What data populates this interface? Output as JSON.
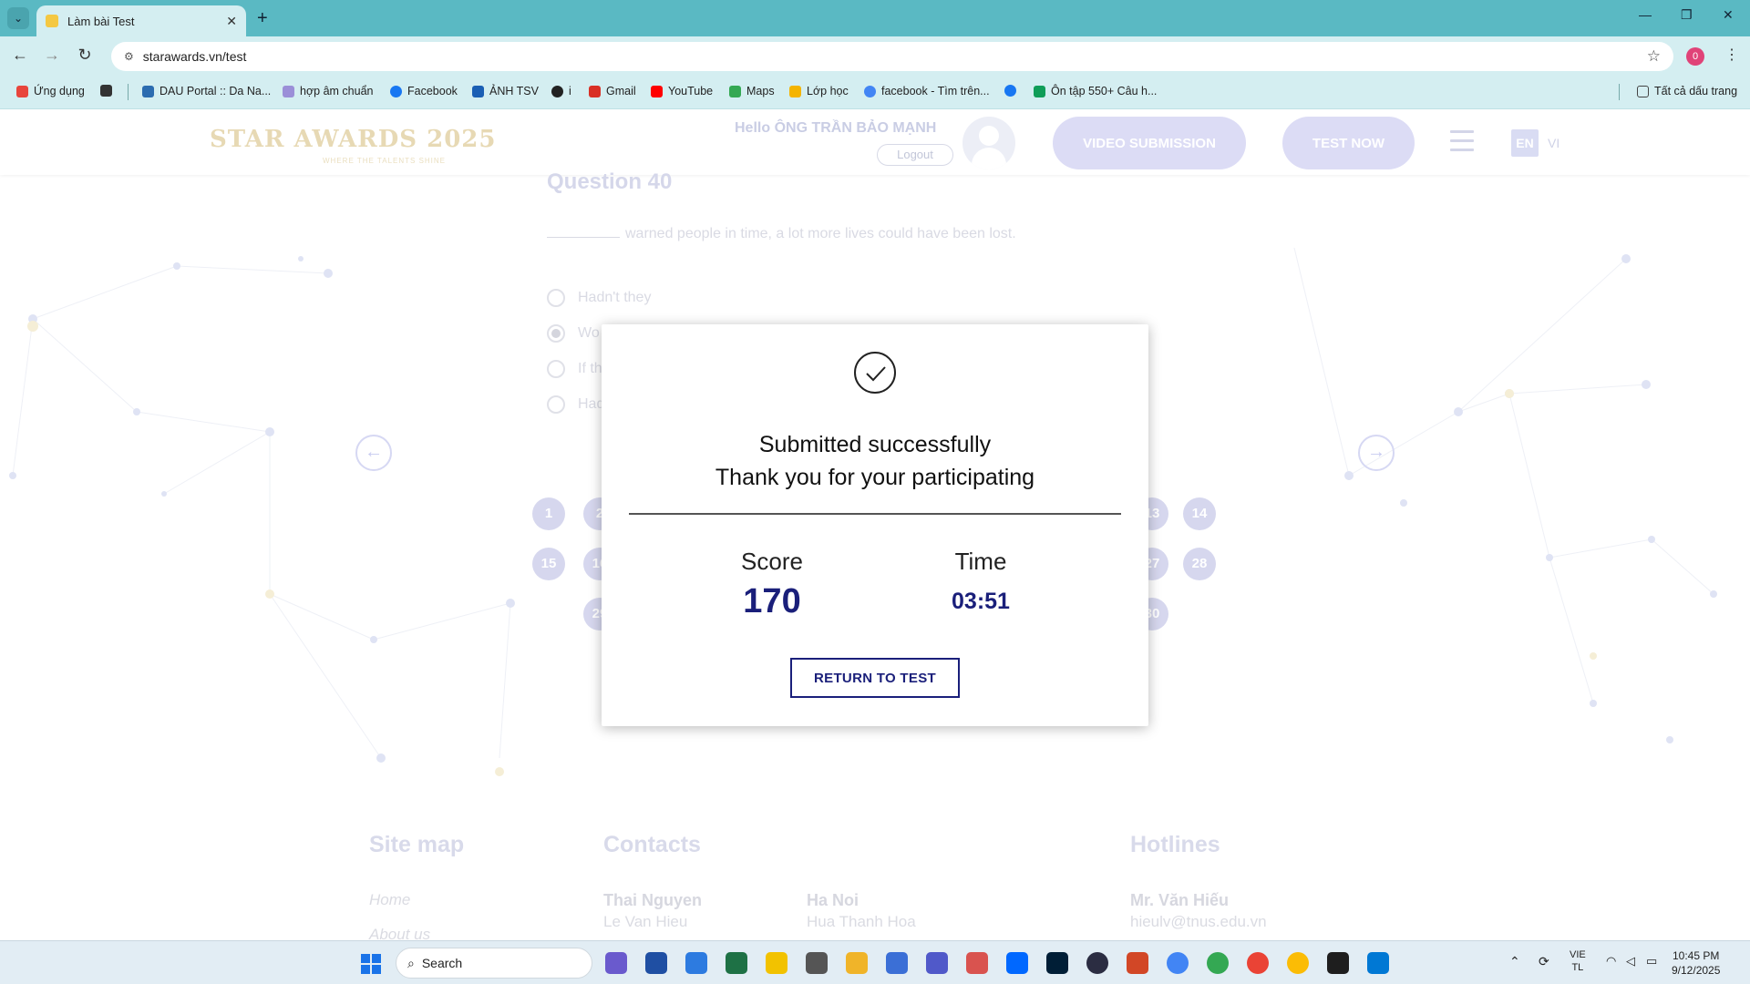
{
  "browser": {
    "tab_title": "Làm bài Test",
    "url": "starawards.vn/test",
    "profile_badge": "0",
    "bookmarks": [
      {
        "label": "Ứng dụng",
        "color": "#e8453c"
      },
      {
        "label": "",
        "color": "#333333"
      },
      {
        "label": "DAU Portal :: Da Na...",
        "color": "#2b6cb0"
      },
      {
        "label": "hợp âm chuẩn",
        "color": "#9b8fd8"
      },
      {
        "label": "Facebook",
        "color": "#1877f2"
      },
      {
        "label": "ẢNH TSV",
        "color": "#1a5fb4"
      },
      {
        "label": "i",
        "color": "#222222"
      },
      {
        "label": "Gmail",
        "color": "#d93025"
      },
      {
        "label": "YouTube",
        "color": "#ff0000"
      },
      {
        "label": "Maps",
        "color": "#34a853"
      },
      {
        "label": "Lớp học",
        "color": "#f4b400"
      },
      {
        "label": "facebook - Tìm trên...",
        "color": "#4285f4"
      },
      {
        "label": "",
        "color": "#1877f2"
      },
      {
        "label": "Ôn tập 550+ Câu h...",
        "color": "#0f9d58"
      }
    ],
    "all_bookmarks": "Tất cả dấu trang"
  },
  "site": {
    "logo": "STAR AWARDS 2025",
    "logo_sub": "WHERE THE TALENTS SHINE",
    "greeting": "Hello ÔNG TRẦN BẢO MẠNH",
    "logout": "Logout",
    "video_submission": "VIDEO SUBMISSION",
    "test_now": "TEST NOW",
    "lang_en": "EN",
    "lang_vi": "VI"
  },
  "question": {
    "title": "Question 40",
    "text": "warned people in time, a lot more lives could have been lost.",
    "options": [
      "Hadn't they",
      "Wo",
      "If th",
      "Had"
    ],
    "selected_index": 1
  },
  "pager": {
    "row1": [
      "1",
      "2",
      "13",
      "14"
    ],
    "row2": [
      "15",
      "16",
      "27",
      "28"
    ],
    "row3": [
      "29",
      "30"
    ]
  },
  "modal": {
    "line1": "Submitted successfully",
    "line2": "Thank you for your participating",
    "score_label": "Score",
    "score_value": "170",
    "time_label": "Time",
    "time_value": "03:51",
    "return_button": "RETURN TO TEST"
  },
  "footer": {
    "site_map": "Site map",
    "contacts": "Contacts",
    "hotlines": "Hotlines",
    "home": "Home",
    "about": "About us",
    "city1": "Thai Nguyen",
    "person1": "Le Van Hieu",
    "city2": "Ha Noi",
    "person2": "Hua Thanh Hoa",
    "hotline_name": "Mr. Văn Hiếu",
    "hotline_email": "hieulv@tnus.edu.vn"
  },
  "taskbar": {
    "search_placeholder": "Search",
    "lang": "VIE",
    "lang2": "TL",
    "time": "10:45 PM",
    "date": "9/12/2025"
  }
}
